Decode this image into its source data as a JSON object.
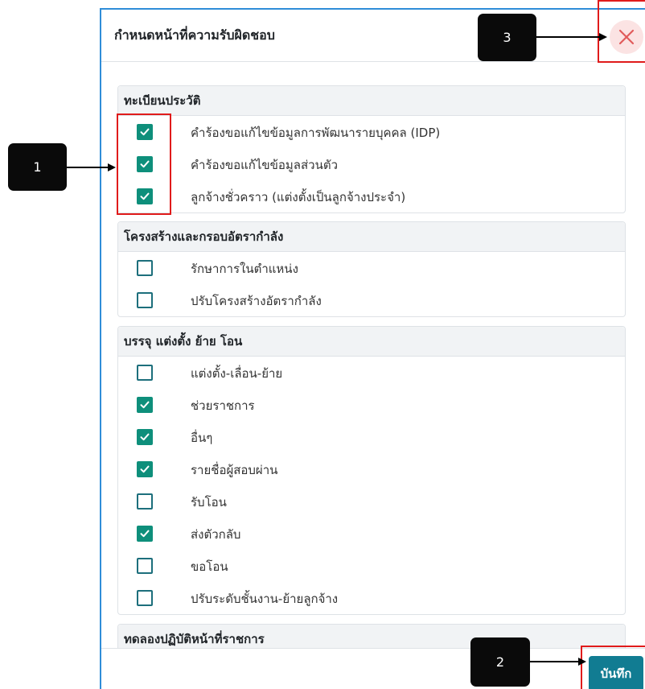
{
  "modal": {
    "title": "กำหนดหน้าที่ความรับผิดชอบ",
    "close_icon": "close-icon",
    "save_label": "บันทึก"
  },
  "colors": {
    "accent": "#117c92",
    "checkbox_checked": "#0e8f7b",
    "annotation_red": "#e01b1b"
  },
  "sections": [
    {
      "title": "ทะเบียนประวัติ",
      "items": [
        {
          "label": "คำร้องขอแก้ไขข้อมูลการพัฒนารายบุคคล (IDP)",
          "checked": true
        },
        {
          "label": "คำร้องขอแก้ไขข้อมูลส่วนตัว",
          "checked": true
        },
        {
          "label": "ลูกจ้างชั่วคราว (แต่งตั้งเป็นลูกจ้างประจำ)",
          "checked": true
        }
      ]
    },
    {
      "title": "โครงสร้างและกรอบอัตรากำลัง",
      "items": [
        {
          "label": "รักษาการในตำแหน่ง",
          "checked": false
        },
        {
          "label": "ปรับโครงสร้างอัตรากำลัง",
          "checked": false
        }
      ]
    },
    {
      "title": "บรรจุ แต่งตั้ง ย้าย โอน",
      "items": [
        {
          "label": "แต่งตั้ง-เลื่อน-ย้าย",
          "checked": false
        },
        {
          "label": "ช่วยราชการ",
          "checked": true
        },
        {
          "label": "อื่นๆ",
          "checked": true
        },
        {
          "label": "รายชื่อผู้สอบผ่าน",
          "checked": true
        },
        {
          "label": "รับโอน",
          "checked": false
        },
        {
          "label": "ส่งตัวกลับ",
          "checked": true
        },
        {
          "label": "ขอโอน",
          "checked": false
        },
        {
          "label": "ปรับระดับชั้นงาน-ย้ายลูกจ้าง",
          "checked": false
        }
      ]
    },
    {
      "title": "ทดลองปฏิบัติหน้าที่ราชการ",
      "items": []
    }
  ],
  "annotations": [
    {
      "label": "1"
    },
    {
      "label": "2"
    },
    {
      "label": "3"
    }
  ]
}
